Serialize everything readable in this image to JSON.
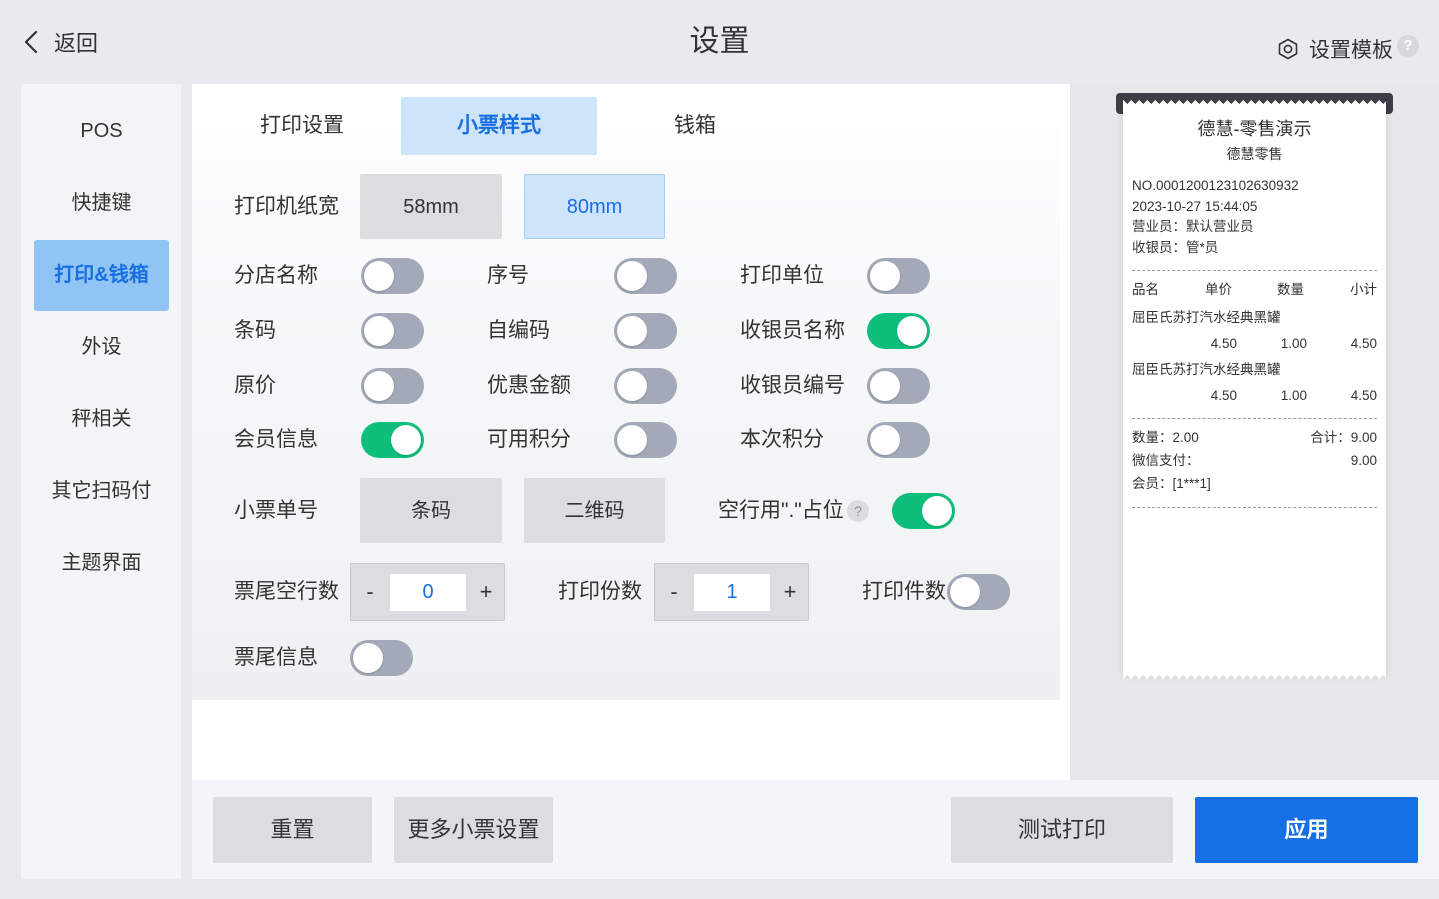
{
  "header": {
    "back_label": "返回",
    "title": "设置",
    "template_label": "设置模板",
    "help_glyph": "?"
  },
  "icons": {
    "back": "chevron-left-icon",
    "template": "hexagon-gear-icon",
    "help": "question-mark-icon"
  },
  "sidebar": {
    "items": [
      {
        "label": "POS",
        "active": false
      },
      {
        "label": "快捷键",
        "active": false
      },
      {
        "label": "打印&钱箱",
        "active": true
      },
      {
        "label": "外设",
        "active": false
      },
      {
        "label": "秤相关",
        "active": false
      },
      {
        "label": "其它扫码付",
        "active": false
      },
      {
        "label": "主题界面",
        "active": false
      }
    ]
  },
  "tabs": [
    {
      "label": "打印设置",
      "active": false
    },
    {
      "label": "小票样式",
      "active": true
    },
    {
      "label": "钱箱",
      "active": false
    }
  ],
  "paper_width": {
    "label": "打印机纸宽",
    "options": [
      {
        "label": "58mm",
        "selected": false
      },
      {
        "label": "80mm",
        "selected": true
      }
    ]
  },
  "toggle_grid": [
    [
      {
        "label": "分店名称",
        "on": false
      },
      {
        "label": "序号",
        "on": false
      },
      {
        "label": "打印单位",
        "on": false
      }
    ],
    [
      {
        "label": "条码",
        "on": false
      },
      {
        "label": "自编码",
        "on": false
      },
      {
        "label": "收银员名称",
        "on": true
      }
    ],
    [
      {
        "label": "原价",
        "on": false
      },
      {
        "label": "优惠金额",
        "on": false
      },
      {
        "label": "收银员编号",
        "on": false
      }
    ],
    [
      {
        "label": "会员信息",
        "on": true
      },
      {
        "label": "可用积分",
        "on": false
      },
      {
        "label": "本次积分",
        "on": false
      }
    ]
  ],
  "ticket_no": {
    "label": "小票单号",
    "options": [
      {
        "label": "条码",
        "selected": false
      },
      {
        "label": "二维码",
        "selected": false
      }
    ]
  },
  "blank_line_placeholder": {
    "label": "空行用\".\"占位",
    "help_glyph": "?",
    "on": true
  },
  "footer_blank_lines": {
    "label": "票尾空行数",
    "minus": "-",
    "plus": "+",
    "value": "0"
  },
  "print_copies": {
    "label": "打印份数",
    "minus": "-",
    "plus": "+",
    "value": "1"
  },
  "print_item_count": {
    "label": "打印件数",
    "on": false
  },
  "footer_info": {
    "label": "票尾信息",
    "on": false
  },
  "receipt": {
    "store_title": "德慧-零售演示",
    "store_subtitle": "德慧零售",
    "order_no": "NO.0001200123102630932",
    "datetime": "2023-10-27 15:44:05",
    "salesperson": "营业员：默认营业员",
    "cashier": "收银员：管*员",
    "columns": [
      "品名",
      "单价",
      "数量",
      "小计"
    ],
    "items": [
      {
        "name": "屈臣氏苏打汽水经典黑罐",
        "price": "4.50",
        "qty": "1.00",
        "subtotal": "4.50"
      },
      {
        "name": "屈臣氏苏打汽水经典黑罐",
        "price": "4.50",
        "qty": "1.00",
        "subtotal": "4.50"
      }
    ],
    "summary": {
      "qty": "数量：2.00",
      "total": "合计：9.00",
      "payment_method": "微信支付：",
      "payment_amount": "9.00",
      "member": "会员：[1***1]"
    }
  },
  "actions": {
    "reset": "重置",
    "more": "更多小票设置",
    "test_print": "测试打印",
    "apply": "应用"
  },
  "colors": {
    "primary": "#1570e6",
    "accent_text": "#1a6fe0",
    "selected_bg": "#cde4fb",
    "sidebar_active_bg": "#8fc4f5",
    "toggle_on": "#0dbf7b",
    "toggle_off": "#a3a9b8"
  }
}
